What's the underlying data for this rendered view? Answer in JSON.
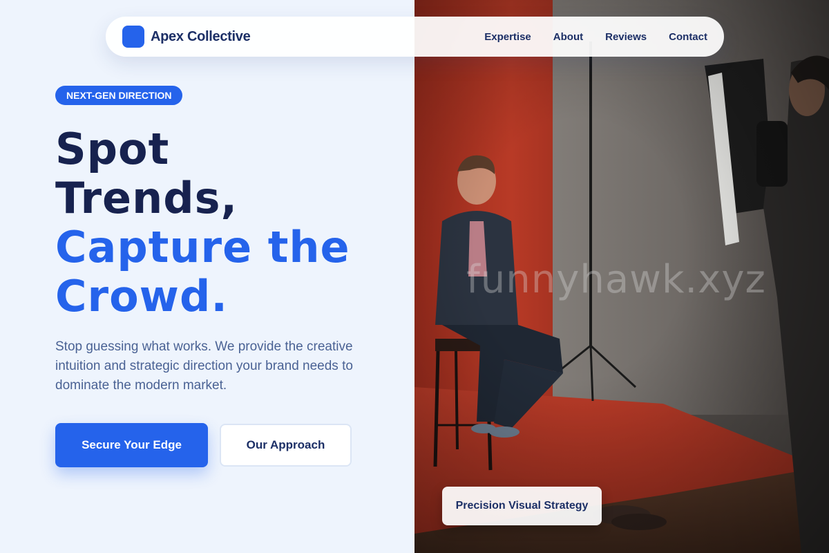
{
  "brand": {
    "name": "Apex Collective",
    "accent_color": "#2563eb",
    "dark_color": "#17224f"
  },
  "nav": {
    "links": [
      "Expertise",
      "About",
      "Reviews",
      "Contact"
    ]
  },
  "hero": {
    "tag": "NEXT-GEN DIRECTION",
    "headline_line1": "Spot",
    "headline_line2": "Trends,",
    "headline_line3": "Capture the",
    "headline_line4": "Crowd.",
    "subtext": "Stop guessing what works. We provide the creative intuition and strategic direction your brand needs to dominate the modern market.",
    "primary_button": "Secure Your Edge",
    "secondary_button": "Our Approach"
  },
  "photo": {
    "description_icon": "studio-photoshoot-image",
    "badge": "Precision Visual Strategy",
    "watermark": "funnyhawk.xyz"
  }
}
